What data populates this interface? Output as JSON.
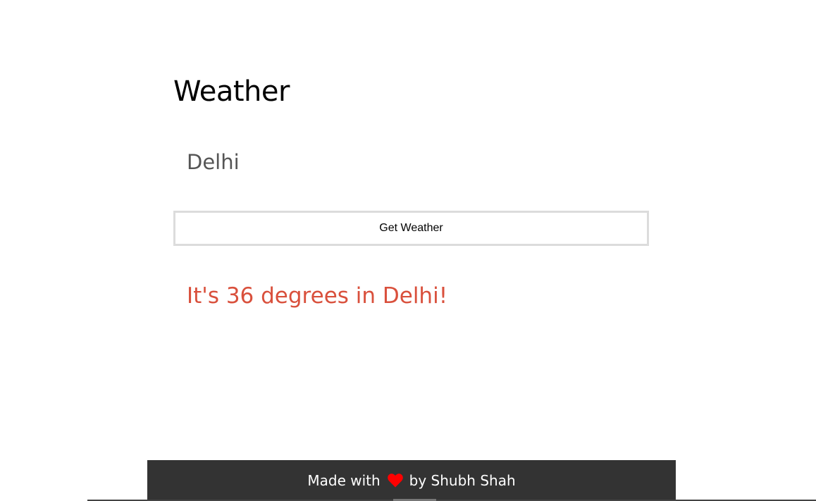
{
  "header": {
    "title": "Weather"
  },
  "search": {
    "city_value": "Delhi"
  },
  "actions": {
    "get_weather_label": "Get Weather"
  },
  "result": {
    "message": "It's 36 degrees in Delhi!"
  },
  "footer": {
    "text_before": "Made with",
    "text_after": "by Shubh Shah",
    "heart_icon": "heart-icon",
    "heart_color": "#ff0000"
  },
  "colors": {
    "accent": "#d9503c",
    "footer_bg": "#333333",
    "button_border": "#dcdcdc"
  }
}
